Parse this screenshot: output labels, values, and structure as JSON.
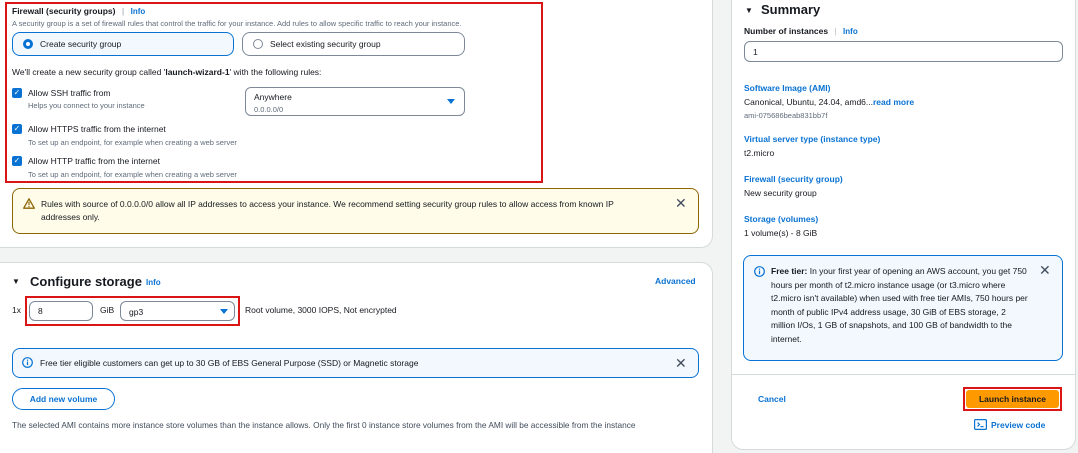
{
  "firewall": {
    "title": "Firewall (security groups)",
    "info": "Info",
    "description": "A security group is a set of firewall rules that control the traffic for your instance. Add rules to allow specific traffic to reach your instance.",
    "create_option": "Create security group",
    "existing_option": "Select existing security group",
    "new_group_prefix": "We'll create a new security group called '",
    "new_group_name": "launch-wizard-1",
    "new_group_suffix": "' with the following rules:",
    "rules": [
      {
        "label": "Allow SSH traffic from",
        "desc": "Helps you connect to your instance",
        "checked": true
      },
      {
        "label": "Allow HTTPS traffic from the internet",
        "desc": "To set up an endpoint, for example when creating a web server",
        "checked": true
      },
      {
        "label": "Allow HTTP traffic from the internet",
        "desc": "To set up an endpoint, for example when creating a web server",
        "checked": true
      }
    ],
    "ssh_source": {
      "value": "Anywhere",
      "sub": "0.0.0.0/0"
    },
    "warning": "Rules with source of 0.0.0.0/0 allow all IP addresses to access your instance. We recommend setting security group rules to allow access from known IP addresses only."
  },
  "storage": {
    "title": "Configure storage",
    "info": "Info",
    "advanced": "Advanced",
    "multiplier": "1x",
    "size": "8",
    "unit": "GiB",
    "volume_type": "gp3",
    "volume_desc": "Root volume,  3000 IOPS,  Not encrypted",
    "free_tier_note": "Free tier eligible customers can get up to 30 GB of EBS General Purpose (SSD) or Magnetic storage",
    "add_volume": "Add new volume",
    "note": "The selected AMI contains more instance store volumes than the instance allows. Only the first 0 instance store volumes from the AMI will be accessible from the instance"
  },
  "summary": {
    "title": "Summary",
    "instances_label": "Number of instances",
    "info": "Info",
    "instances_value": "1",
    "ami_label": "Software Image (AMI)",
    "ami_value": "Canonical, Ubuntu, 24.04, amd6...",
    "ami_more": "read more",
    "ami_id": "ami-075686beab831bb7f",
    "type_label": "Virtual server type (instance type)",
    "type_value": "t2.micro",
    "firewall_label": "Firewall (security group)",
    "firewall_value": "New security group",
    "storage_label": "Storage (volumes)",
    "storage_value": "1 volume(s) - 8 GiB",
    "free_tier_title": "Free tier:",
    "free_tier_text": " In your first year of opening an AWS account, you get 750 hours per month of t2.micro instance usage (or t3.micro where t2.micro isn't available) when used with free tier AMIs, 750 hours per month of public IPv4 address usage, 30 GiB of EBS storage, 2 million I/Os, 1 GB of snapshots, and 100 GB of bandwidth to the internet.",
    "cancel": "Cancel",
    "launch": "Launch instance",
    "preview": "Preview code"
  },
  "colors": {
    "accent": "#0972d3",
    "launch": "#ff9900",
    "highlight": "#d91515",
    "warning_border": "#8d6605"
  },
  "icons": [
    "caret-down-icon",
    "warning-icon",
    "info-icon",
    "close-icon",
    "checkmark-icon",
    "code-icon"
  ]
}
